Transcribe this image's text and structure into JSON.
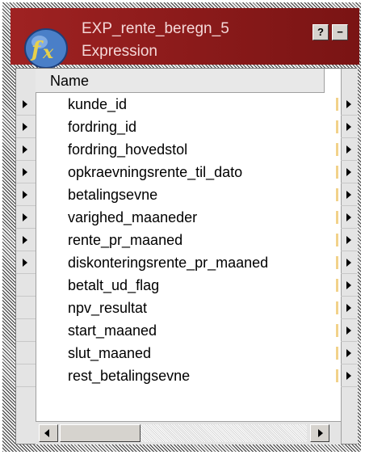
{
  "window": {
    "title": "EXP_rente_beregn_5",
    "subtitle": "Expression",
    "help_label": "?",
    "minimize_label": "−",
    "logo_icon": "expression-transformation-icon",
    "header_color": "#9f2222"
  },
  "grid": {
    "column_header": "Name",
    "rows": [
      {
        "name": "kunde_id",
        "input_port": true
      },
      {
        "name": "fordring_id",
        "input_port": true
      },
      {
        "name": "fordring_hovedstol",
        "input_port": true
      },
      {
        "name": "opkraevningsrente_til_dato",
        "input_port": true
      },
      {
        "name": "betalingsevne",
        "input_port": true
      },
      {
        "name": "varighed_maaneder",
        "input_port": true
      },
      {
        "name": "rente_pr_maaned",
        "input_port": true
      },
      {
        "name": "diskonteringsrente_pr_maaned",
        "input_port": true
      },
      {
        "name": "betalt_ud_flag",
        "input_port": false
      },
      {
        "name": "npv_resultat",
        "input_port": false
      },
      {
        "name": "start_maaned",
        "input_port": false
      },
      {
        "name": "slut_maaned",
        "input_port": false
      },
      {
        "name": "rest_betalingsevne",
        "input_port": false
      }
    ]
  },
  "scrollbar": {
    "left_arrow_icon": "scroll-left-icon",
    "right_arrow_icon": "scroll-right-icon"
  }
}
